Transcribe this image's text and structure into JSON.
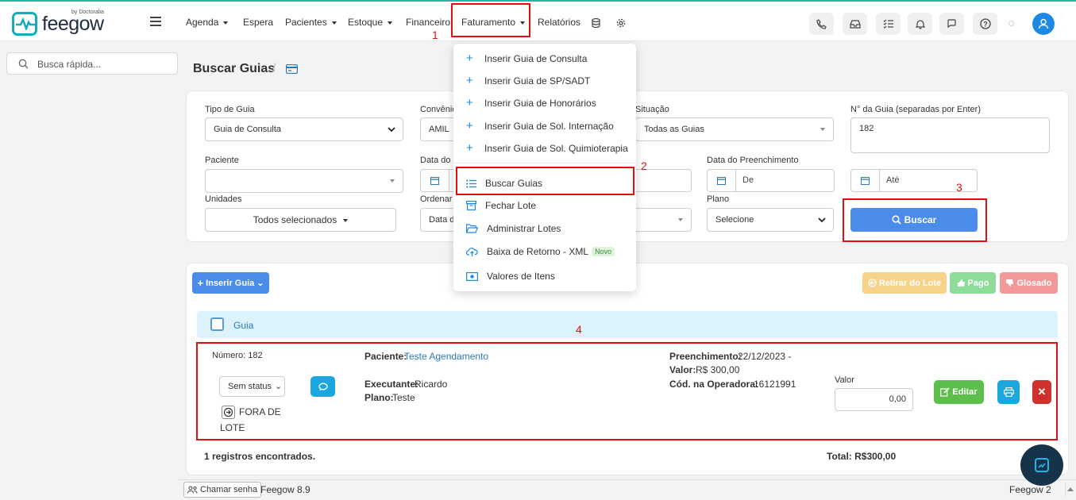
{
  "brand": {
    "name": "feegow",
    "by": "by Doctoralia"
  },
  "nav": [
    {
      "label": "Agenda",
      "caret": true
    },
    {
      "label": "Espera",
      "caret": false
    },
    {
      "label": "Pacientes",
      "caret": true
    },
    {
      "label": "Estoque",
      "caret": true
    },
    {
      "label": "Financeiro",
      "caret": false
    },
    {
      "label": "Faturamento",
      "caret": true
    },
    {
      "label": "Relatórios",
      "caret": false
    }
  ],
  "quick_search": {
    "placeholder": "Busca rápida..."
  },
  "page": {
    "title": "Buscar Guias"
  },
  "form": {
    "tipo_label": "Tipo de Guia",
    "tipo_value": "Guia de Consulta",
    "convenio_label": "Convênio",
    "convenio_value": "AMIL",
    "situacao_label": "Situação",
    "situacao_value": "Todas as Guias",
    "nguia_label": "N° da Guia (separadas por Enter)",
    "nguia_value": "182",
    "paciente_label": "Paciente",
    "data_label": "Data do",
    "preench_label": "Data do Preenchimento",
    "de_placeholder": "De",
    "ate_placeholder": "Até",
    "unidades_label": "Unidades",
    "unidades_value": "Todos selecionados",
    "ordenar_label": "Ordenar",
    "ordenar_value": "Data d",
    "plano_label": "Plano",
    "plano_value": "Selecione",
    "buscar_label": "Buscar"
  },
  "menu": {
    "items": [
      "Inserir Guia de Consulta",
      "Inserir Guia de SP/SADT",
      "Inserir Guia de Honorários",
      "Inserir Guia de Sol. Internação",
      "Inserir Guia de Sol. Quimioterapia",
      "Buscar Guias",
      "Fechar Lote",
      "Administrar Lotes",
      "Baixa de Retorno - XML",
      "Valores de Itens"
    ],
    "novo_badge": "Novo"
  },
  "actions": {
    "inserir": "Inserir Guia",
    "retirar": "Retirar do Lote",
    "pago": "Pago",
    "glosado": "Glosado",
    "colors": {
      "retirar": "#f6d389",
      "pago": "#8fdc9a",
      "glosado": "#f29a9a"
    }
  },
  "list": {
    "header": "Guia",
    "numero": "Número: 182",
    "status": "Sem status",
    "fora": "FORA DE",
    "lote": "LOTE",
    "paciente_label": "Paciente:",
    "paciente": "Teste Agendamento",
    "executante_label": "Executante:",
    "executante": "Ricardo",
    "plano_label": "Plano:",
    "plano": "Teste",
    "preench_label": "Preenchimento:",
    "preench": "22/12/2023 -",
    "valor_label": "Valor:",
    "valor": "R$ 300,00",
    "cod_label": "Cód. na Operadora:",
    "cod": "16121991",
    "valor_field_label": "Valor",
    "valor_field": "0,00",
    "editar": "Editar"
  },
  "summary": {
    "registros": "1 registros encontrados.",
    "total": "Total: R$300,00"
  },
  "footer": {
    "chamar": "Chamar senha",
    "version": "Feegow 8.9",
    "right": "Feegow 2"
  },
  "annotations": [
    "1",
    "2",
    "3",
    "4"
  ]
}
